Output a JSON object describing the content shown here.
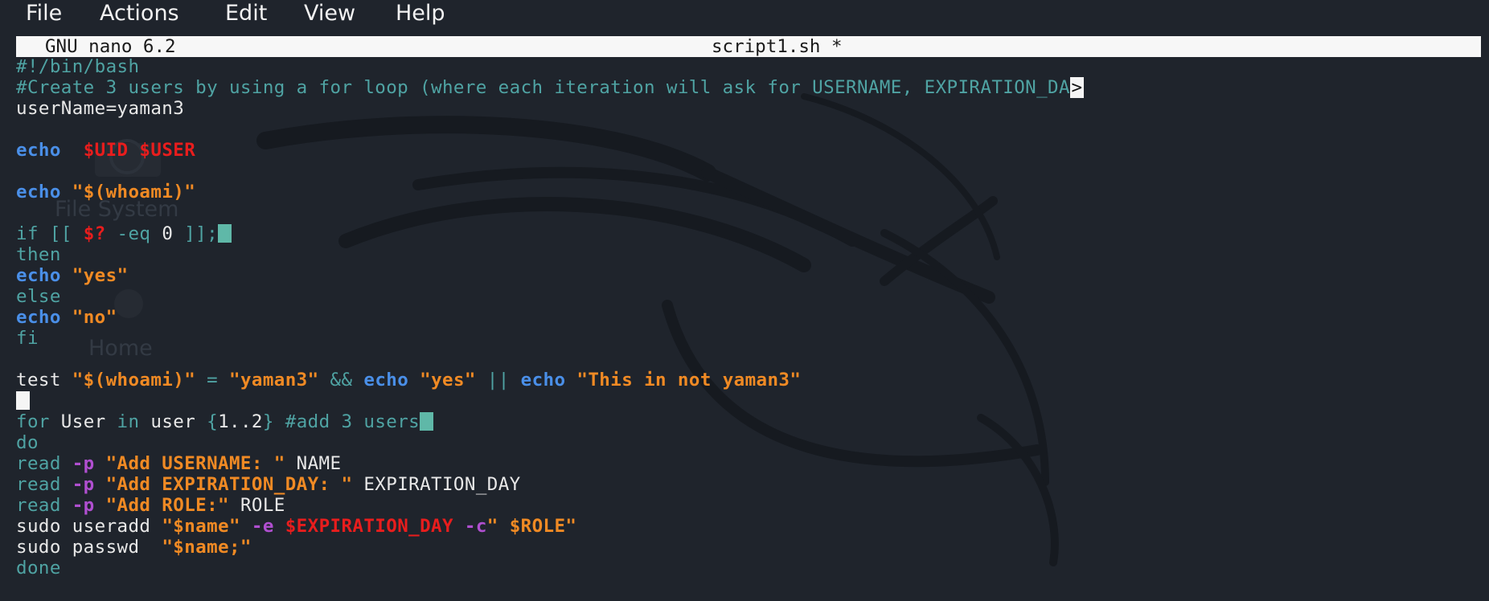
{
  "menu": [
    "File",
    "Actions",
    "Edit",
    "View",
    "Help"
  ],
  "desktop": {
    "icons": [
      {
        "label": "File System"
      },
      {
        "label": "Home"
      }
    ]
  },
  "nano": {
    "version": "GNU nano 6.2",
    "filename": "script1.sh *",
    "more_indicator": ">"
  },
  "script": [
    [
      {
        "t": "#!/bin/bash",
        "c": "teal"
      }
    ],
    [
      {
        "t": "#Create 3 users by using a for loop (where each iteration will ask for USERNAME, EXPIRATION_DA",
        "c": "teal"
      }
    ],
    [
      {
        "t": "userName=yaman3",
        "c": "plain"
      }
    ],
    [],
    [
      {
        "t": "echo",
        "c": "blue"
      },
      {
        "t": "  ",
        "c": "plain"
      },
      {
        "t": "$UID $USER",
        "c": "red"
      }
    ],
    [],
    [
      {
        "t": "echo",
        "c": "blue"
      },
      {
        "t": " ",
        "c": "plain"
      },
      {
        "t": "\"$(whoami)\"",
        "c": "orange"
      }
    ],
    [],
    [
      {
        "t": "if [[ ",
        "c": "teal"
      },
      {
        "t": "$?",
        "c": "red"
      },
      {
        "t": " -eq ",
        "c": "teal"
      },
      {
        "t": "0",
        "c": "plain"
      },
      {
        "t": " ]];",
        "c": "teal"
      }
    ],
    [
      {
        "t": "then",
        "c": "teal"
      }
    ],
    [
      {
        "t": "echo",
        "c": "blue"
      },
      {
        "t": " ",
        "c": "plain"
      },
      {
        "t": "\"yes\"",
        "c": "orange"
      }
    ],
    [
      {
        "t": "else",
        "c": "teal"
      }
    ],
    [
      {
        "t": "echo",
        "c": "blue"
      },
      {
        "t": " ",
        "c": "plain"
      },
      {
        "t": "\"no\"",
        "c": "orange"
      }
    ],
    [
      {
        "t": "fi",
        "c": "teal"
      }
    ],
    [],
    [
      {
        "t": "test ",
        "c": "plain"
      },
      {
        "t": "\"$(whoami)\"",
        "c": "orange"
      },
      {
        "t": " = ",
        "c": "teal"
      },
      {
        "t": "\"yaman3\"",
        "c": "orange"
      },
      {
        "t": " && ",
        "c": "teal"
      },
      {
        "t": "echo",
        "c": "blue"
      },
      {
        "t": " ",
        "c": "plain"
      },
      {
        "t": "\"yes\"",
        "c": "orange"
      },
      {
        "t": " || ",
        "c": "teal"
      },
      {
        "t": "echo",
        "c": "blue"
      },
      {
        "t": " ",
        "c": "plain"
      },
      {
        "t": "\"This in not yaman3\"",
        "c": "orange"
      }
    ],
    [],
    [
      {
        "t": "for ",
        "c": "teal"
      },
      {
        "t": "User ",
        "c": "plain"
      },
      {
        "t": "in ",
        "c": "teal"
      },
      {
        "t": "user ",
        "c": "plain"
      },
      {
        "t": "{",
        "c": "teal"
      },
      {
        "t": "1..2",
        "c": "plain"
      },
      {
        "t": "} ",
        "c": "teal"
      },
      {
        "t": "#add 3 users",
        "c": "teal"
      }
    ],
    [
      {
        "t": "do",
        "c": "teal"
      }
    ],
    [
      {
        "t": "read ",
        "c": "teal"
      },
      {
        "t": "-p ",
        "c": "purple"
      },
      {
        "t": "\"Add USERNAME: \"",
        "c": "orange"
      },
      {
        "t": " NAME",
        "c": "plain"
      }
    ],
    [
      {
        "t": "read ",
        "c": "teal"
      },
      {
        "t": "-p ",
        "c": "purple"
      },
      {
        "t": "\"Add EXPIRATION_DAY: \"",
        "c": "orange"
      },
      {
        "t": " EXPIRATION_DAY",
        "c": "plain"
      }
    ],
    [
      {
        "t": "read ",
        "c": "teal"
      },
      {
        "t": "-p ",
        "c": "purple"
      },
      {
        "t": "\"Add ROLE:\"",
        "c": "orange"
      },
      {
        "t": " ROLE",
        "c": "plain"
      }
    ],
    [
      {
        "t": "sudo useradd ",
        "c": "plain"
      },
      {
        "t": "\"$name\"",
        "c": "orange"
      },
      {
        "t": " ",
        "c": "plain"
      },
      {
        "t": "-e ",
        "c": "purple"
      },
      {
        "t": "$EXPIRATION_DAY",
        "c": "red"
      },
      {
        "t": " ",
        "c": "plain"
      },
      {
        "t": "-c",
        "c": "purple"
      },
      {
        "t": "\" $ROLE\"",
        "c": "orange"
      }
    ],
    [
      {
        "t": "sudo passwd  ",
        "c": "plain"
      },
      {
        "t": "\"$name;\"",
        "c": "orange"
      }
    ],
    [
      {
        "t": "done",
        "c": "teal"
      }
    ]
  ]
}
